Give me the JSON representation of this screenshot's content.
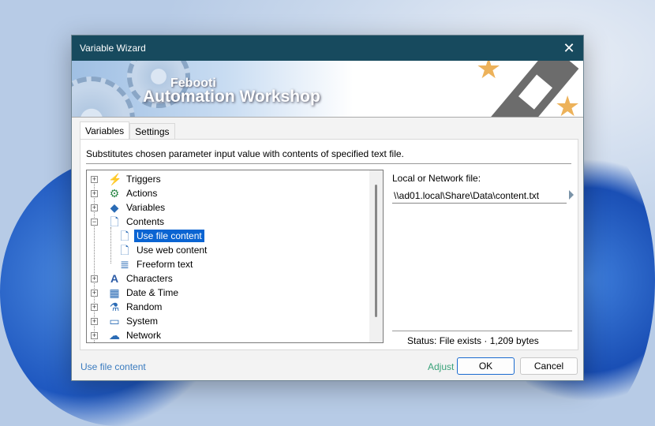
{
  "window": {
    "title": "Variable Wizard"
  },
  "banner": {
    "brand_small": "Febooti",
    "brand_large": "Automation Workshop"
  },
  "tabs": [
    {
      "label": "Variables",
      "active": true
    },
    {
      "label": "Settings",
      "active": false
    }
  ],
  "description": "Substitutes chosen parameter input value with contents of specified text file.",
  "tree": {
    "items": [
      {
        "label": "Triggers",
        "icon": "lightning-icon"
      },
      {
        "label": "Actions",
        "icon": "gear-icon"
      },
      {
        "label": "Variables",
        "icon": "variables-icon"
      },
      {
        "label": "Contents",
        "icon": "document-icon",
        "expanded": true,
        "children": [
          {
            "label": "Use file content",
            "selected": true
          },
          {
            "label": "Use web content"
          },
          {
            "label": "Freeform text"
          }
        ]
      },
      {
        "label": "Characters",
        "icon": "font-icon"
      },
      {
        "label": "Date & Time",
        "icon": "calendar-icon"
      },
      {
        "label": "Random",
        "icon": "flask-icon"
      },
      {
        "label": "System",
        "icon": "monitor-icon"
      },
      {
        "label": "Network",
        "icon": "cloud-icon"
      }
    ]
  },
  "file": {
    "label": "Local or Network file:",
    "value": "\\\\ad01.local\\Share\\Data\\content.txt"
  },
  "status": {
    "text": "Status:  File exists · 1,209 bytes"
  },
  "footer": {
    "link": "Use file content",
    "adjust": "Adjust",
    "ok": "OK",
    "cancel": "Cancel"
  },
  "colors": {
    "titlebar": "#174a5e",
    "selection": "#0a64d2",
    "link": "#3a7bbf",
    "adjust": "#3aa27a"
  }
}
